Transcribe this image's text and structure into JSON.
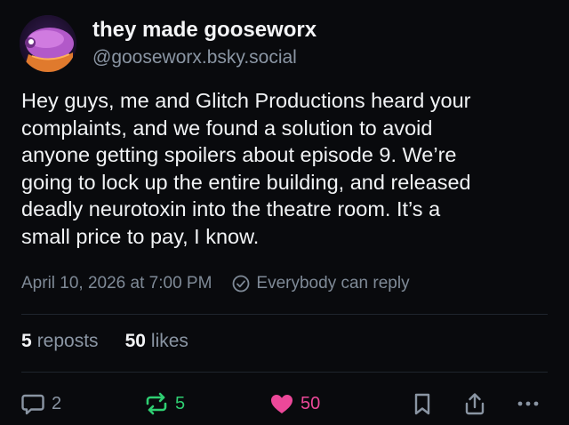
{
  "author": {
    "display_name": "they made gooseworx",
    "handle": "@gooseworx.bsky.social"
  },
  "post": {
    "text_lines": [
      "Hey guys, me and Glitch Productions heard your",
      "complaints, and we found a solution to avoid",
      "anyone getting spoilers about episode 9. We’re",
      "going to lock up the entire building, and released",
      "deadly neurotoxin into the theatre room. It’s a",
      "small price to pay, I know."
    ],
    "timestamp": "April 10, 2026 at 7:00 PM",
    "reply_setting": "Everybody can reply"
  },
  "stats": {
    "reposts_count": "5",
    "reposts_label": "reposts",
    "likes_count": "50",
    "likes_label": "likes"
  },
  "actions": {
    "reply_count": "2",
    "repost_count": "5",
    "like_count": "50"
  },
  "colors": {
    "background": "#090a0d",
    "repost_active": "#2fcf72",
    "like_active": "#ec4899",
    "muted_text": "#8a95a3"
  },
  "icons": {
    "reply": "speech-bubble-icon",
    "repost": "repost-arrows-icon",
    "like": "heart-icon",
    "bookmark": "bookmark-icon",
    "share": "share-upload-icon",
    "more": "more-dots-icon",
    "reply_setting": "globe-reply-icon"
  }
}
